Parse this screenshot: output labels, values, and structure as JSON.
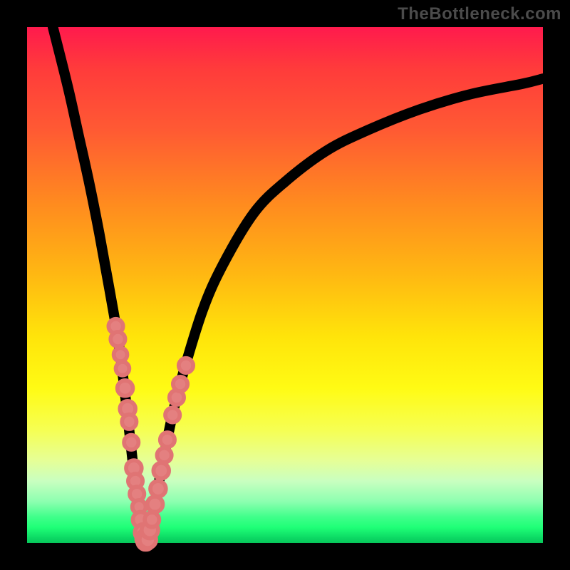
{
  "watermark": "TheBottleneck.com",
  "chart_data": {
    "type": "line",
    "title": "",
    "xlabel": "",
    "ylabel": "",
    "xlim": [
      0,
      100
    ],
    "ylim": [
      0,
      100
    ],
    "grid": false,
    "gradient_meaning": "vertical severity gradient: red (top) = high bottleneck, green (bottom) = no bottleneck",
    "curve_min_x": 23,
    "series": [
      {
        "name": "bottleneck-curve",
        "x": [
          5,
          8,
          10,
          12,
          14,
          16,
          18,
          20,
          21,
          22,
          23,
          24,
          26,
          28,
          30,
          34,
          38,
          44,
          50,
          58,
          66,
          76,
          86,
          96,
          100
        ],
        "y": [
          100,
          88,
          79,
          70,
          60,
          49,
          37,
          20,
          11,
          4,
          0,
          4,
          14,
          24,
          32,
          45,
          54,
          64,
          70,
          76,
          80,
          84,
          87,
          89,
          90
        ]
      }
    ],
    "annotations": [
      {
        "name": "data-point-cluster",
        "description": "pink sample markers concentrated around the curve minimum",
        "points": [
          {
            "x": 17.2,
            "y": 42.0,
            "r": 1.4
          },
          {
            "x": 17.6,
            "y": 39.5,
            "r": 1.4
          },
          {
            "x": 18.1,
            "y": 36.5,
            "r": 1.3
          },
          {
            "x": 18.5,
            "y": 33.8,
            "r": 1.3
          },
          {
            "x": 19.0,
            "y": 30.0,
            "r": 1.5
          },
          {
            "x": 19.5,
            "y": 26.0,
            "r": 1.5
          },
          {
            "x": 19.8,
            "y": 23.5,
            "r": 1.4
          },
          {
            "x": 20.2,
            "y": 19.5,
            "r": 1.4
          },
          {
            "x": 20.7,
            "y": 14.5,
            "r": 1.5
          },
          {
            "x": 21.0,
            "y": 12.0,
            "r": 1.4
          },
          {
            "x": 21.3,
            "y": 9.5,
            "r": 1.4
          },
          {
            "x": 21.7,
            "y": 7.0,
            "r": 1.3
          },
          {
            "x": 22.0,
            "y": 4.5,
            "r": 1.5
          },
          {
            "x": 22.5,
            "y": 2.0,
            "r": 1.6
          },
          {
            "x": 22.8,
            "y": 0.8,
            "r": 1.6
          },
          {
            "x": 23.0,
            "y": 0.3,
            "r": 1.6
          },
          {
            "x": 23.4,
            "y": 0.6,
            "r": 1.6
          },
          {
            "x": 23.8,
            "y": 2.5,
            "r": 1.6
          },
          {
            "x": 24.2,
            "y": 4.5,
            "r": 1.4
          },
          {
            "x": 24.8,
            "y": 7.5,
            "r": 1.5
          },
          {
            "x": 25.4,
            "y": 10.5,
            "r": 1.5
          },
          {
            "x": 26.0,
            "y": 14.0,
            "r": 1.5
          },
          {
            "x": 26.6,
            "y": 17.0,
            "r": 1.4
          },
          {
            "x": 27.2,
            "y": 20.0,
            "r": 1.4
          },
          {
            "x": 28.2,
            "y": 24.8,
            "r": 1.4
          },
          {
            "x": 29.0,
            "y": 28.2,
            "r": 1.4
          },
          {
            "x": 29.7,
            "y": 30.8,
            "r": 1.4
          },
          {
            "x": 30.8,
            "y": 34.4,
            "r": 1.4
          }
        ]
      }
    ]
  }
}
